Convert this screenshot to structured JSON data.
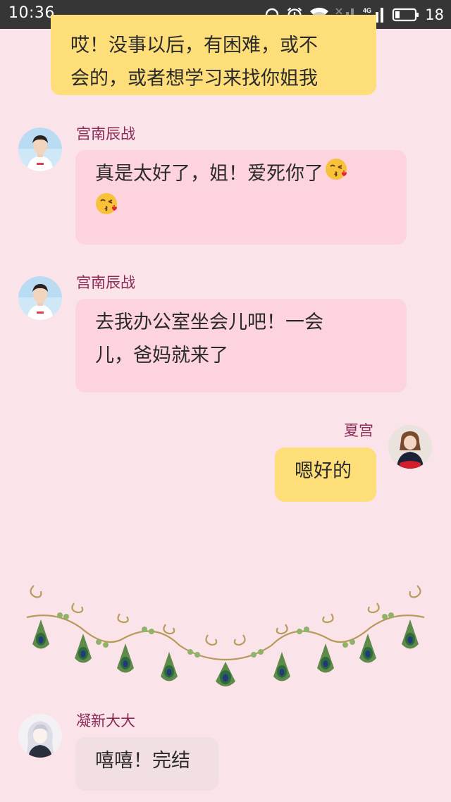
{
  "status_bar": {
    "time": "10:36",
    "battery_level": "18",
    "icons": [
      "headphones-icon",
      "alarm-icon",
      "wifi-icon",
      "signal-icon",
      "4g-signal-icon",
      "battery-icon"
    ]
  },
  "messages": [
    {
      "id": "m0",
      "side": "right",
      "sender": "",
      "lines": [
        "哎！没事以后，有困难，或不",
        "会的，或者想学习来找你姐我"
      ],
      "color": "#fdde79"
    },
    {
      "id": "m1",
      "side": "left",
      "sender": "宫南辰战",
      "text": "真是太好了，姐！爱死你了",
      "emoji": [
        "kiss-emoji",
        "kiss-emoji"
      ],
      "color": "#fdd3dd"
    },
    {
      "id": "m2",
      "side": "left",
      "sender": "宫南辰战",
      "lines": [
        "去我办公室坐会儿吧！一会",
        "儿，爸妈就来了"
      ],
      "color": "#fdd3dd"
    },
    {
      "id": "m3",
      "side": "right",
      "sender": "夏宫",
      "text": "嗯好的",
      "color": "#fdde79"
    },
    {
      "id": "m4",
      "side": "left",
      "sender": "凝新大大",
      "text": "嘻嘻！完结",
      "color": "#f2dfe1"
    }
  ],
  "decoration": "peacock-feather-garland",
  "colors": {
    "background": "#fbe3ea",
    "status_bar": "#363636",
    "sender_name": "#8b2a55",
    "bubble_yellow": "#fdde79",
    "bubble_pink": "#fdd3dd",
    "bubble_grey": "#f2dfe1"
  }
}
